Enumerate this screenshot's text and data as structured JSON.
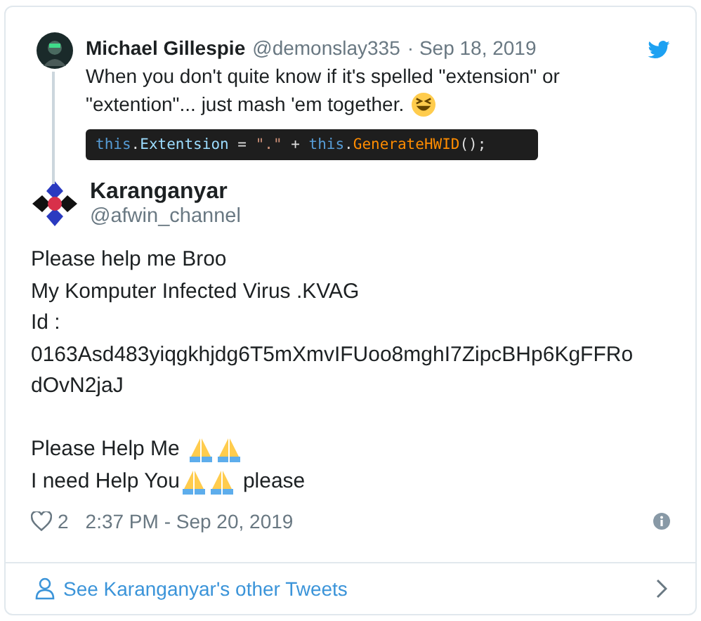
{
  "quoted_tweet": {
    "name": "Michael Gillespie",
    "handle": "@demonslay335",
    "date": "· Sep 18, 2019",
    "text_lines": [
      "When you don't quite know if it's spelled \"extension\" or",
      "\"extention\"... just mash 'em together."
    ],
    "code": [
      {
        "text": "this",
        "kind": "keyword"
      },
      {
        "text": ".",
        "kind": "plain"
      },
      {
        "text": "Extentsion",
        "kind": "member"
      },
      {
        "text": " = ",
        "kind": "plain"
      },
      {
        "text": "\".\"",
        "kind": "string"
      },
      {
        "text": " + ",
        "kind": "plain"
      },
      {
        "text": "this",
        "kind": "keyword"
      },
      {
        "text": ".",
        "kind": "plain"
      },
      {
        "text": "GenerateHWID",
        "kind": "method"
      },
      {
        "text": "();",
        "kind": "plain"
      }
    ]
  },
  "tweet": {
    "name": "Karanganyar",
    "handle": "@afwin_channel",
    "lines": [
      {
        "kind": "text",
        "parts": [
          {
            "kind": "text",
            "text": "Please help me Broo"
          }
        ]
      },
      {
        "kind": "text",
        "parts": [
          {
            "kind": "text",
            "text": "My Komputer Infected Virus .KVAG"
          }
        ]
      },
      {
        "kind": "text",
        "parts": [
          {
            "kind": "text",
            "text": "Id :"
          }
        ]
      },
      {
        "kind": "text",
        "parts": [
          {
            "kind": "text",
            "text": "0163Asd483yiqgkhjdg6T5mXmvIFUoo8mghI7ZipcBHp6KgFFRo"
          }
        ]
      },
      {
        "kind": "text",
        "parts": [
          {
            "kind": "text",
            "text": "dOvN2jaJ"
          }
        ]
      },
      {
        "kind": "blank"
      },
      {
        "kind": "text",
        "parts": [
          {
            "kind": "text",
            "text": "Please Help Me"
          },
          {
            "kind": "space"
          },
          {
            "kind": "pray"
          },
          {
            "kind": "pray"
          }
        ]
      },
      {
        "kind": "text",
        "parts": [
          {
            "kind": "text",
            "text": "I need Help You"
          },
          {
            "kind": "pray"
          },
          {
            "kind": "pray"
          },
          {
            "kind": "space"
          },
          {
            "kind": "text",
            "text": "please"
          }
        ]
      }
    ],
    "likes": "2",
    "time": "2:37 PM - Sep 20, 2019"
  },
  "footer_link": "See Karanganyar's other Tweets"
}
